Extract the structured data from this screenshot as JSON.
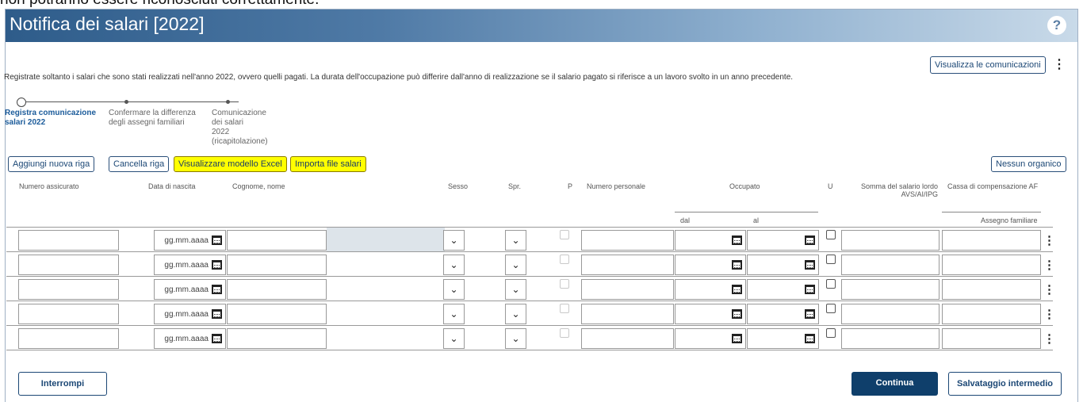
{
  "top_fragment": "non potranno essere riconosciuti correttamente.",
  "title": "Notifica dei salari [2022]",
  "help_icon": "question-circle-icon",
  "header_actions": {
    "view_communications": "Visualizza le comunicazioni"
  },
  "intro_text": "Registrate soltanto i salari che sono stati realizzati nell'anno 2022, ovvero quelli pagati. La durata dell'occupazione può differire dall'anno di realizzazione se il salario pagato si riferisce a un lavoro svolto in un anno precedente.",
  "steps": [
    {
      "line1": "Registra comunicazione",
      "line2": "salari 2022",
      "active": true
    },
    {
      "line1": "Confermare la differenza",
      "line2": "degli assegni familiari",
      "active": false
    },
    {
      "line1": "Comunicazione dei salari",
      "line2": "2022 (ricapitolazione)",
      "active": false
    }
  ],
  "toolbar": {
    "add_row": "Aggiungi nuova riga",
    "delete_row": "Cancella riga",
    "view_excel": "Visualizzare modello Excel",
    "import_file": "Importa file salari",
    "no_staff": "Nessun organico"
  },
  "highlight_color": "#ffff00",
  "columns": {
    "insured_number": "Numero assicurato",
    "birth_date": "Data di nascita",
    "name": "Cognome, nome",
    "sex": "Sesso",
    "spr": "Spr.",
    "p": "P",
    "personal_number": "Numero personale",
    "employed": "Occupato",
    "u": "U",
    "gross_salary_line1": "Somma del salario lordo",
    "gross_salary_line2": "AVS/AI/IPG",
    "compensation_fund": "Cassa di compensazione AF",
    "from": "dal",
    "to": "al",
    "family_allowance": "Assegno familiare"
  },
  "date_placeholder": "gg.mm.aaaa",
  "rows": [
    1,
    2,
    3,
    4,
    5
  ],
  "footer": {
    "cancel": "Interrompi",
    "continue": "Continua",
    "save_draft": "Salvataggio intermedio"
  },
  "colors": {
    "primary": "#0f3f6b",
    "title_bar": "#2e5c8a"
  }
}
